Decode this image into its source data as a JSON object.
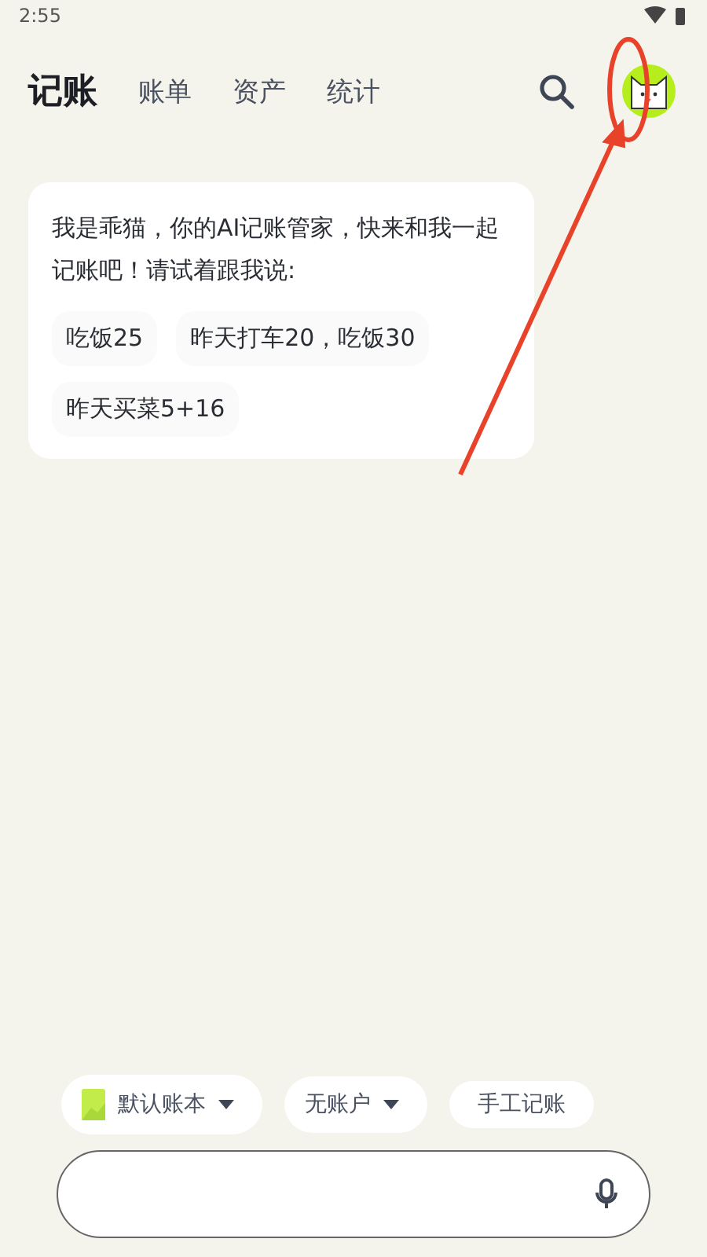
{
  "status_bar": {
    "time": "2:55"
  },
  "tabs": [
    {
      "label": "记账",
      "selected": true
    },
    {
      "label": "账单",
      "selected": false
    },
    {
      "label": "资产",
      "selected": false
    },
    {
      "label": "统计",
      "selected": false
    }
  ],
  "message": {
    "text": "我是乖猫，你的AI记账管家，快来和我一起记账吧！请试着跟我说:",
    "suggestions": [
      "吃饭25",
      "昨天打车20，吃饭30",
      "昨天买菜5+16"
    ]
  },
  "chips": [
    {
      "kind": "book",
      "label": "默认账本"
    },
    {
      "kind": "dropdown",
      "label": "无账户"
    },
    {
      "kind": "button",
      "label": "手工记账"
    }
  ]
}
